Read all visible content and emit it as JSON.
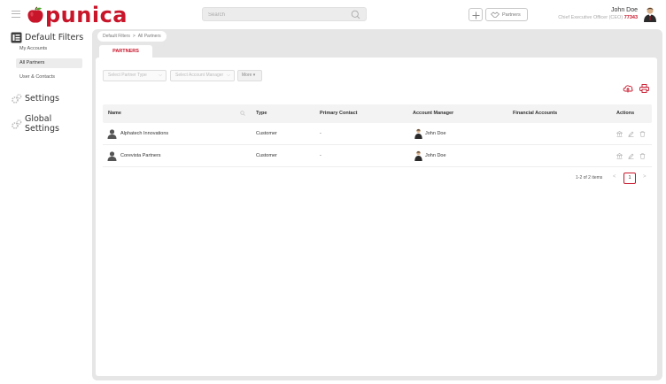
{
  "app": {
    "logo_text": "punica",
    "brand_color": "#c8152a"
  },
  "search": {
    "placeholder": "Search"
  },
  "header": {
    "partners_label": "Partners",
    "user_name": "John Doe",
    "user_role": "Chief Executive Officer (CEO)",
    "user_code": "77343"
  },
  "sidebar": {
    "default_filters_title": "Default Filters",
    "items": [
      {
        "label": "My Accounts"
      },
      {
        "label": "All Partners"
      },
      {
        "label": "User & Contacts"
      }
    ],
    "settings_title": "Settings",
    "global_settings_title": "Global Settings"
  },
  "breadcrumb": {
    "part1": "Default Filters",
    "sep": ">",
    "part2": "All Partners"
  },
  "tab": {
    "label": "PARTNERS"
  },
  "filters": {
    "partner_type": "Select Partner Type",
    "account_manager": "Select Account Manager",
    "more": "More"
  },
  "table": {
    "columns": [
      "Name",
      "Type",
      "Primary Contact",
      "Account Manager",
      "Financial Accounts",
      "Actions"
    ],
    "rows": [
      {
        "name": "Alphatech Innovations",
        "type": "Customer",
        "primary_contact": "-",
        "account_manager": "John Doe",
        "financial_accounts": ""
      },
      {
        "name": "Corevista Partners",
        "type": "Customer",
        "primary_contact": "-",
        "account_manager": "John Doe",
        "financial_accounts": ""
      }
    ]
  },
  "pagination": {
    "summary": "1-2 of 2 items",
    "current_page": "1",
    "prev": "<",
    "next": ">"
  },
  "icons": [
    "hamburger-icon",
    "search-icon",
    "plus-icon",
    "handshake-icon",
    "filter-icon",
    "gear-icon",
    "cloud-upload-icon",
    "printer-icon",
    "user-icon",
    "bank-icon",
    "edit-icon",
    "trash-icon"
  ]
}
